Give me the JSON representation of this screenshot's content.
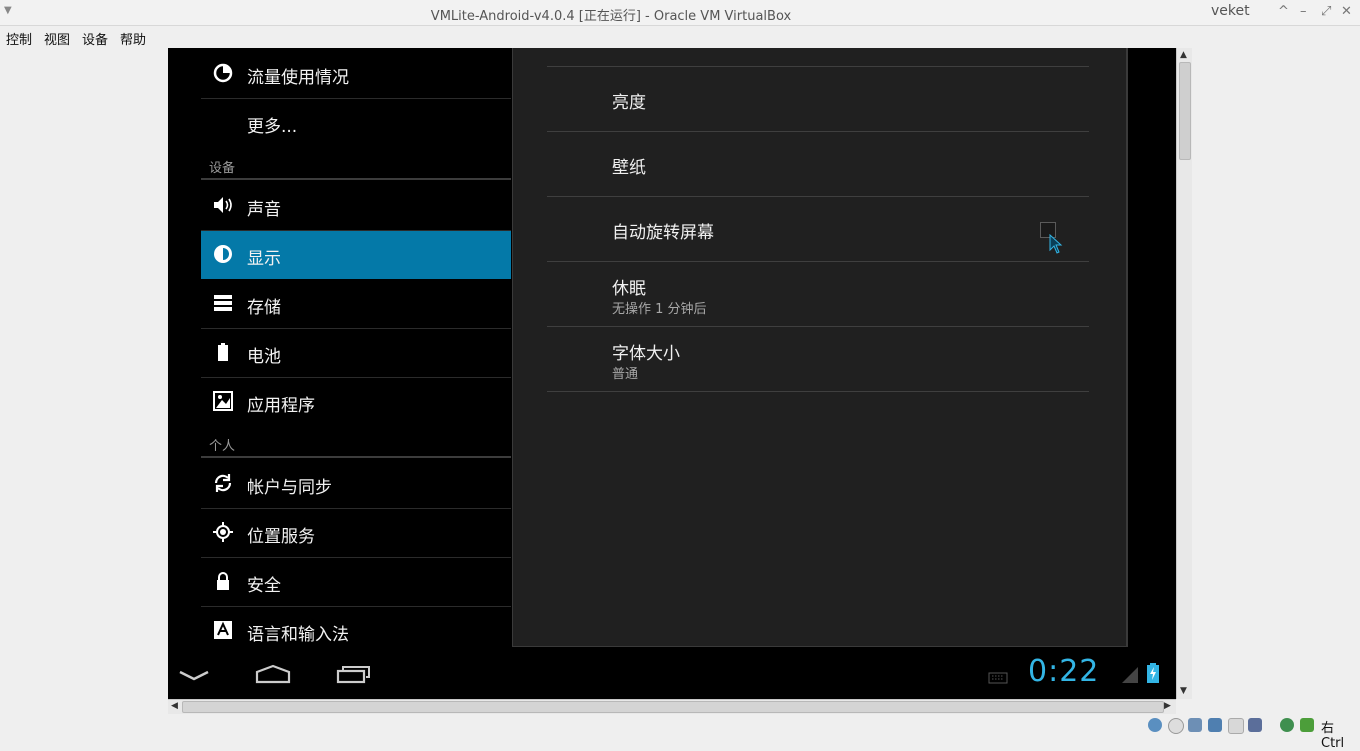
{
  "window": {
    "title": "VMLite-Android-v4.0.4 [正在运行] - Oracle VM VirtualBox",
    "user": "veket",
    "buttons": {
      "up": "^",
      "minimize": "–",
      "maximize": "⤢",
      "close": "✕"
    }
  },
  "menubar": {
    "items": [
      "控制",
      "视图",
      "设备",
      "帮助"
    ]
  },
  "settings_left": {
    "items_top": [
      {
        "label": "流量使用情况",
        "icon": "data-usage-icon"
      },
      {
        "label": "更多...",
        "icon": ""
      }
    ],
    "category_device": "设备",
    "device_items": [
      {
        "label": "声音",
        "icon": "speaker-icon"
      },
      {
        "label": "显示",
        "icon": "display-icon",
        "selected": true
      },
      {
        "label": "存储",
        "icon": "storage-icon"
      },
      {
        "label": "电池",
        "icon": "battery-icon"
      },
      {
        "label": "应用程序",
        "icon": "apps-icon"
      }
    ],
    "category_personal": "个人",
    "personal_items": [
      {
        "label": "帐户与同步",
        "icon": "sync-icon"
      },
      {
        "label": "位置服务",
        "icon": "location-icon"
      },
      {
        "label": "安全",
        "icon": "lock-icon"
      },
      {
        "label": "语言和输入法",
        "icon": "language-icon"
      }
    ]
  },
  "display_settings": {
    "items": [
      {
        "title": "亮度",
        "summary": ""
      },
      {
        "title": "壁纸",
        "summary": ""
      },
      {
        "title": "自动旋转屏幕",
        "summary": "",
        "checkbox": false
      },
      {
        "title": "休眠",
        "summary": "无操作 1 分钟后"
      },
      {
        "title": "字体大小",
        "summary": "普通"
      }
    ]
  },
  "android_navbar": {
    "clock": "0:22"
  },
  "statusbar": {
    "hostkey": "右 Ctrl"
  },
  "colors": {
    "accent": "#0479a8",
    "clock": "#33b5e5",
    "panel": "#202020"
  }
}
